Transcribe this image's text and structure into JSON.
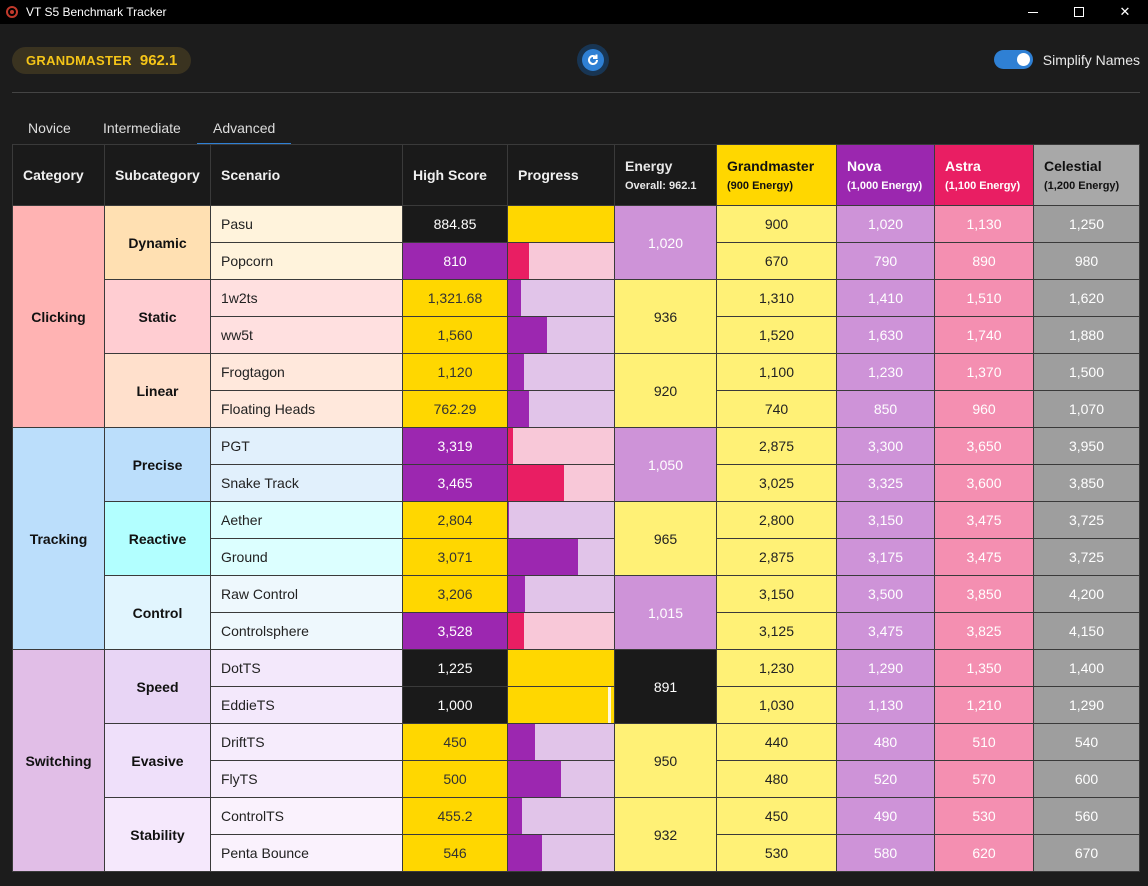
{
  "window": {
    "title": "VT S5 Benchmark Tracker"
  },
  "rank": {
    "name": "GRANDMASTER",
    "score": "962.1"
  },
  "toggle": {
    "label": "Simplify Names",
    "on": true
  },
  "tabs": [
    {
      "label": "Novice"
    },
    {
      "label": "Intermediate"
    },
    {
      "label": "Advanced"
    }
  ],
  "colors": {
    "accent": "#2f80d4",
    "grandmaster": "#ffd700",
    "nova": "#9b27af",
    "astra": "#e91e63",
    "celestial": "#a8a8a8"
  },
  "table": {
    "headers": {
      "category": "Category",
      "subcategory": "Subcategory",
      "scenario": "Scenario",
      "high_score": "High Score",
      "progress": "Progress",
      "energy": "Energy",
      "energy_sub": "Overall: 962.1",
      "gm": "Grandmaster",
      "gm_sub": "(900 Energy)",
      "nova": "Nova",
      "nova_sub": "(1,000 Energy)",
      "astra": "Astra",
      "astra_sub": "(1,100 Energy)",
      "cel": "Celestial",
      "cel_sub": "(1,200 Energy)"
    },
    "rows": [
      {
        "cat": "Clicking",
        "sub": "Dynamic",
        "scen": "Pasu",
        "hs": "884.85",
        "rank": "gm-complete",
        "progress": 1.0,
        "energy": "1,020",
        "energy_rank": "nova",
        "gm": "900",
        "nova": "1,020",
        "astra": "1,130",
        "cel": "1,250"
      },
      {
        "scen": "Popcorn",
        "hs": "810",
        "rank": "nova",
        "progress": 0.2,
        "gm": "670",
        "nova": "790",
        "astra": "890",
        "cel": "980"
      },
      {
        "sub": "Static",
        "scen": "1w2ts",
        "hs": "1,321.68",
        "rank": "gm",
        "progress": 0.12,
        "energy": "936",
        "energy_rank": "gm",
        "gm": "1,310",
        "nova": "1,410",
        "astra": "1,510",
        "cel": "1,620"
      },
      {
        "scen": "ww5t",
        "hs": "1,560",
        "rank": "gm",
        "progress": 0.37,
        "gm": "1,520",
        "nova": "1,630",
        "astra": "1,740",
        "cel": "1,880"
      },
      {
        "sub": "Linear",
        "scen": "Frogtagon",
        "hs": "1,120",
        "rank": "gm",
        "progress": 0.15,
        "energy": "920",
        "energy_rank": "gm",
        "gm": "1,100",
        "nova": "1,230",
        "astra": "1,370",
        "cel": "1,500"
      },
      {
        "scen": "Floating Heads",
        "hs": "762.29",
        "rank": "gm",
        "progress": 0.2,
        "gm": "740",
        "nova": "850",
        "astra": "960",
        "cel": "1,070"
      },
      {
        "cat": "Tracking",
        "sub": "Precise",
        "scen": "PGT",
        "hs": "3,319",
        "rank": "nova",
        "progress": 0.05,
        "energy": "1,050",
        "energy_rank": "nova",
        "gm": "2,875",
        "nova": "3,300",
        "astra": "3,650",
        "cel": "3,950"
      },
      {
        "scen": "Snake Track",
        "hs": "3,465",
        "rank": "nova",
        "progress": 0.53,
        "gm": "3,025",
        "nova": "3,325",
        "astra": "3,600",
        "cel": "3,850"
      },
      {
        "sub": "Reactive",
        "scen": "Aether",
        "hs": "2,804",
        "rank": "gm",
        "progress": 0.01,
        "energy": "965",
        "energy_rank": "gm",
        "gm": "2,800",
        "nova": "3,150",
        "astra": "3,475",
        "cel": "3,725"
      },
      {
        "scen": "Ground",
        "hs": "3,071",
        "rank": "gm",
        "progress": 0.66,
        "gm": "2,875",
        "nova": "3,175",
        "astra": "3,475",
        "cel": "3,725"
      },
      {
        "sub": "Control",
        "scen": "Raw Control",
        "hs": "3,206",
        "rank": "gm",
        "progress": 0.16,
        "energy": "1,015",
        "energy_rank": "nova",
        "gm": "3,150",
        "nova": "3,500",
        "astra": "3,850",
        "cel": "4,200"
      },
      {
        "scen": "Controlsphere",
        "hs": "3,528",
        "rank": "nova",
        "progress": 0.15,
        "gm": "3,125",
        "nova": "3,475",
        "astra": "3,825",
        "cel": "4,150"
      },
      {
        "cat": "Switching",
        "sub": "Speed",
        "scen": "DotTS",
        "hs": "1,225",
        "rank": "none",
        "progress": 1.0,
        "energy": "891",
        "energy_rank": "none",
        "gm": "1,230",
        "nova": "1,290",
        "astra": "1,350",
        "cel": "1,400"
      },
      {
        "scen": "EddieTS",
        "hs": "1,000",
        "rank": "none",
        "progress": 0.97,
        "gm": "1,030",
        "nova": "1,130",
        "astra": "1,210",
        "cel": "1,290"
      },
      {
        "sub": "Evasive",
        "scen": "DriftTS",
        "hs": "450",
        "rank": "gm",
        "progress": 0.25,
        "energy": "950",
        "energy_rank": "gm",
        "gm": "440",
        "nova": "480",
        "astra": "510",
        "cel": "540"
      },
      {
        "scen": "FlyTS",
        "hs": "500",
        "rank": "gm",
        "progress": 0.5,
        "gm": "480",
        "nova": "520",
        "astra": "570",
        "cel": "600"
      },
      {
        "sub": "Stability",
        "scen": "ControlTS",
        "hs": "455.2",
        "rank": "gm",
        "progress": 0.13,
        "energy": "932",
        "energy_rank": "gm",
        "gm": "450",
        "nova": "490",
        "astra": "530",
        "cel": "560"
      },
      {
        "scen": "Penta Bounce",
        "hs": "546",
        "rank": "gm",
        "progress": 0.32,
        "gm": "530",
        "nova": "580",
        "astra": "620",
        "cel": "670"
      }
    ]
  }
}
